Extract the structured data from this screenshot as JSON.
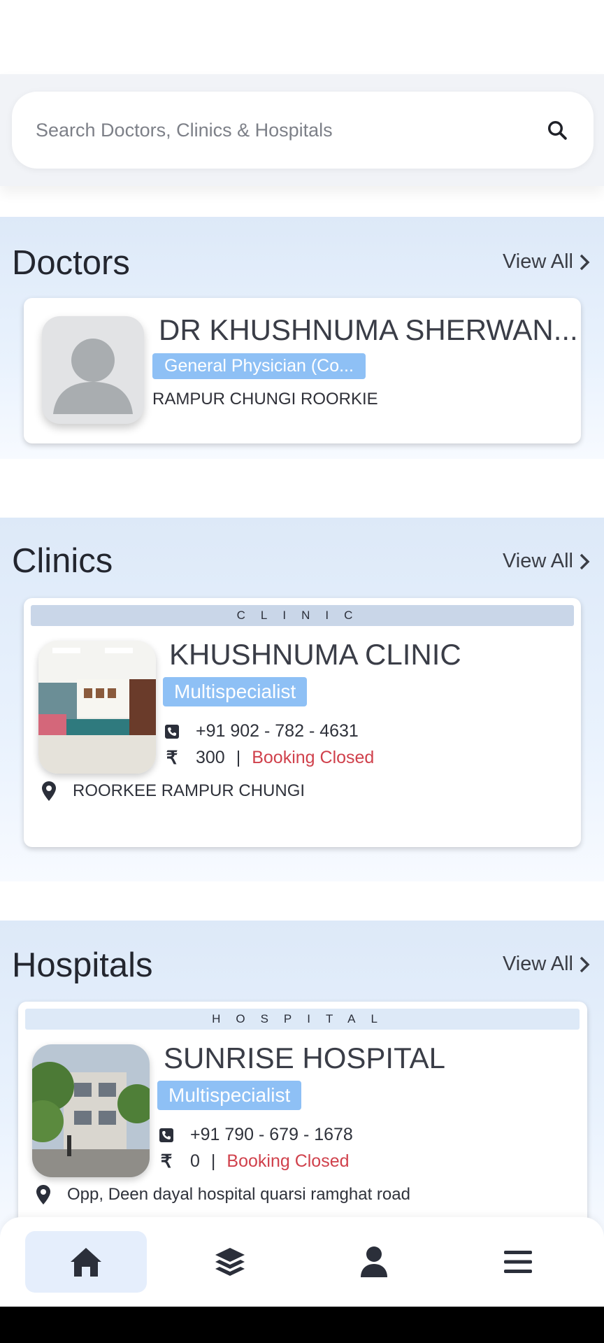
{
  "search": {
    "placeholder": "Search Doctors, Clinics & Hospitals"
  },
  "doctors": {
    "title": "Doctors",
    "view_all": "View All",
    "card": {
      "name": "DR KHUSHNUMA SHERWAN...",
      "specialty": "General Physician (Co...",
      "address": "RAMPUR CHUNGI ROORKIE"
    }
  },
  "clinics": {
    "title": "Clinics",
    "view_all": "View All",
    "card": {
      "type": "CLINIC",
      "name": "KHUSHNUMA CLINIC",
      "specialty": "Multispecialist",
      "phone": "+91 902 - 782 - 4631",
      "fee": "300",
      "separator": "|",
      "status": "Booking Closed",
      "address": "ROORKEE RAMPUR CHUNGI"
    }
  },
  "hospitals": {
    "title": "Hospitals",
    "view_all": "View All",
    "card": {
      "type": "HOSPITAL",
      "name": "SUNRISE HOSPITAL",
      "specialty": "Multispecialist",
      "phone": "+91 790 - 679 - 1678",
      "fee": "0",
      "separator": "|",
      "status": "Booking Closed",
      "address": "Opp, Deen dayal hospital quarsi ramghat road"
    }
  },
  "nav": {
    "items": [
      "home-icon",
      "layers-icon",
      "user-icon",
      "menu-icon"
    ],
    "active": "home"
  },
  "colors": {
    "accent_badge": "#8ec0f5",
    "closed_red": "#d0414c",
    "nav_active_bg": "#e5eefc",
    "text_dark": "#23262f"
  }
}
